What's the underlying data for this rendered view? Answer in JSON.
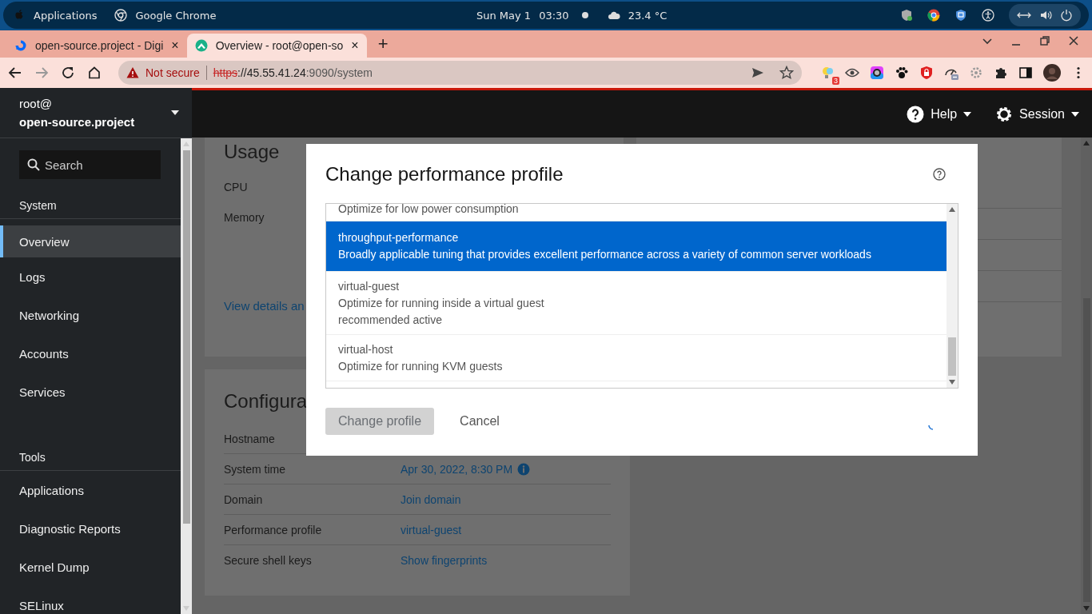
{
  "system_bar": {
    "menu": "Applications",
    "app": "Google Chrome",
    "date": "Sun May 1",
    "time": "03:30",
    "weather": "23.4 °C"
  },
  "browser": {
    "tabs": [
      {
        "title": "open-source.project - Digi",
        "close": "×",
        "selected": false
      },
      {
        "title": "Overview - root@open-so",
        "close": "×",
        "selected": true
      }
    ],
    "new_tab": "+",
    "address": {
      "security": "Not secure",
      "scheme": "https",
      "host": "://45.55.41.24",
      "path": ":9090/system"
    },
    "extension_badge": "3"
  },
  "header": {
    "user": "root@",
    "host": "open-source.project",
    "help": "Help",
    "session": "Session"
  },
  "sidebar": {
    "search_placeholder": "Search",
    "sections": [
      {
        "title": "System",
        "items": [
          {
            "label": "Overview",
            "selected": true
          },
          {
            "label": "Logs",
            "selected": false
          },
          {
            "label": "Networking",
            "selected": false
          },
          {
            "label": "Accounts",
            "selected": false
          },
          {
            "label": "Services",
            "selected": false
          }
        ]
      },
      {
        "title": "Tools",
        "items": [
          {
            "label": "Applications",
            "selected": false
          },
          {
            "label": "Diagnostic Reports",
            "selected": false
          },
          {
            "label": "Kernel Dump",
            "selected": false
          },
          {
            "label": "SELinux",
            "selected": false
          }
        ]
      }
    ]
  },
  "usage_card": {
    "title": "Usage",
    "rows": [
      "CPU",
      "Memory"
    ],
    "link": "View details an"
  },
  "config_card": {
    "title": "Configura",
    "rows": [
      {
        "label": "Hostname"
      },
      {
        "label": "System time",
        "value": "Apr 30, 2022, 8:30 PM",
        "info": true
      },
      {
        "label": "Domain",
        "value": "Join domain"
      },
      {
        "label": "Performance profile",
        "value": "virtual-guest"
      },
      {
        "label": "Secure shell keys",
        "value": "Show fingerprints"
      }
    ]
  },
  "dialog": {
    "title": "Change performance profile",
    "profiles": [
      {
        "description": "Optimize for low power consumption",
        "selected": false
      },
      {
        "name": "throughput-performance",
        "description": "Broadly applicable tuning that provides excellent performance across a variety of common server workloads",
        "selected": true
      },
      {
        "name": "virtual-guest",
        "description": "Optimize for running inside a virtual guest",
        "badges": "recommended active",
        "selected": false
      },
      {
        "name": "virtual-host",
        "description": "Optimize for running KVM guests",
        "selected": false
      }
    ],
    "primary": {
      "label": "Change profile",
      "disabled": true
    },
    "cancel": "Cancel"
  }
}
